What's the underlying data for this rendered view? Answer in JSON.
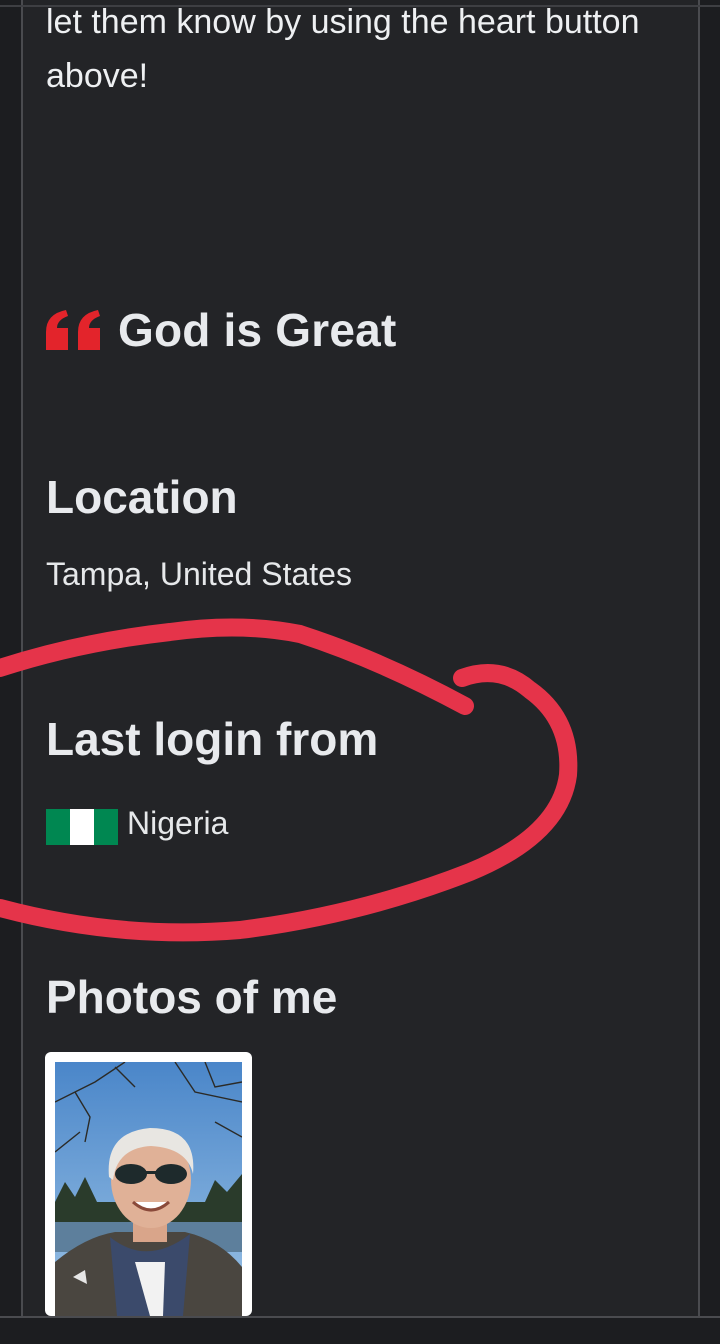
{
  "intro_text": "let them know by using the heart button above!",
  "quote": {
    "icon": "quote-icon",
    "text": "God is Great",
    "icon_color": "#e3242b"
  },
  "location": {
    "heading": "Location",
    "value": "Tampa, United States"
  },
  "last_login": {
    "heading": "Last login from",
    "country": "Nigeria",
    "flag_icon": "nigeria-flag-icon",
    "flag_colors": [
      "#008751",
      "#ffffff",
      "#008751"
    ]
  },
  "photos": {
    "heading": "Photos of me",
    "items": [
      {
        "alt": "profile-photo"
      }
    ]
  },
  "annotation_color": "#e5344a",
  "colors": {
    "panel": "#232427",
    "text": "#e8eaed"
  }
}
